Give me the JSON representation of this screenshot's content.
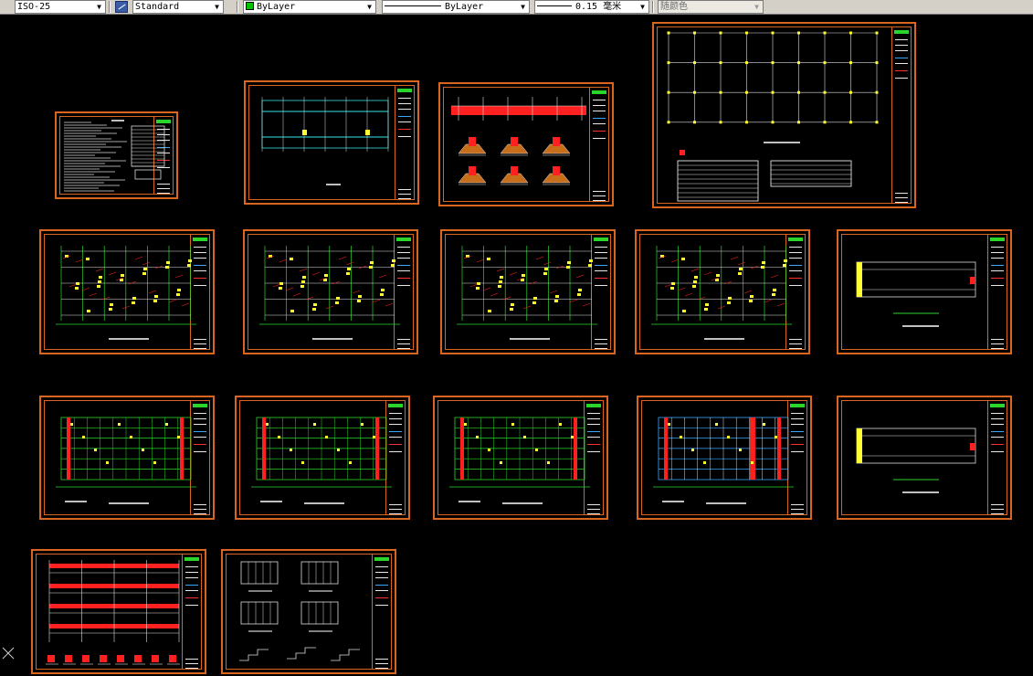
{
  "toolbar": {
    "dimstyle": "ISO-25",
    "textstyle": "Standard",
    "color": "ByLayer",
    "color_hex": "#00c000",
    "linetype": "ByLayer",
    "lineweight": "0.15 毫米",
    "plotstyle": "随颜色"
  },
  "sheets": [
    {
      "id": "design-notes",
      "kind": "notes"
    },
    {
      "id": "foundation-plan",
      "kind": "foundation"
    },
    {
      "id": "footing-details",
      "kind": "footings"
    },
    {
      "id": "column-layout-plan",
      "kind": "column-grid"
    },
    {
      "id": "floor-framing-1",
      "kind": "framing"
    },
    {
      "id": "floor-framing-2",
      "kind": "framing"
    },
    {
      "id": "floor-framing-3",
      "kind": "framing"
    },
    {
      "id": "floor-framing-4",
      "kind": "framing"
    },
    {
      "id": "roof-framing-1",
      "kind": "roof"
    },
    {
      "id": "slab-reinforcement-1",
      "kind": "slab"
    },
    {
      "id": "slab-reinforcement-2",
      "kind": "slab"
    },
    {
      "id": "slab-reinforcement-3",
      "kind": "slab"
    },
    {
      "id": "slab-reinforcement-4",
      "kind": "slab-blue"
    },
    {
      "id": "roof-framing-2",
      "kind": "roof"
    },
    {
      "id": "stair-section",
      "kind": "stair"
    },
    {
      "id": "stair-details",
      "kind": "stair-detail"
    }
  ],
  "colors": {
    "frame": "#d9661f",
    "grid_green": "#2bd52b",
    "axis_white": "#e8e8e8",
    "beam_yellow": "#ffff33",
    "rebar_red": "#ff2020",
    "cyan": "#35e3e3"
  }
}
